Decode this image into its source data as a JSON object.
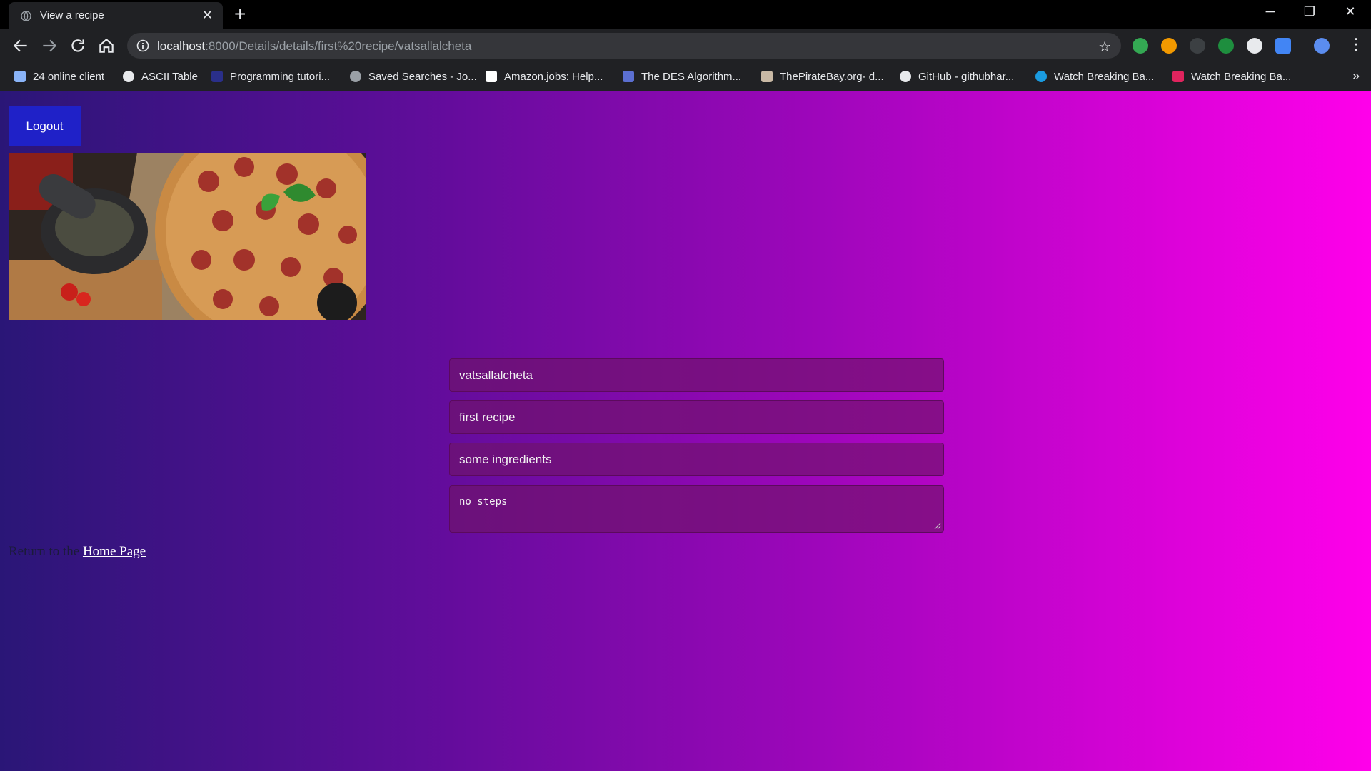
{
  "browser": {
    "tab_title": "View a recipe",
    "url_host": "localhost",
    "url_rest": ":8000/Details/details/first%20recipe/vatsallalcheta",
    "bookmarks": [
      {
        "label": "24 online client",
        "color": "#8ab4f8"
      },
      {
        "label": "ASCII Table",
        "color": "#e8eaed"
      },
      {
        "label": "Programming tutori...",
        "color": "#2a2f8a"
      },
      {
        "label": "Saved Searches - Jo...",
        "color": "#9aa0a6"
      },
      {
        "label": "Amazon.jobs: Help...",
        "color": "#ffffff"
      },
      {
        "label": "The DES Algorithm...",
        "color": "#5b6fd1"
      },
      {
        "label": "ThePirateBay.org- d...",
        "color": "#c9b9a5"
      },
      {
        "label": "GitHub - githubhar...",
        "color": "#e8eaed"
      },
      {
        "label": "Watch Breaking Ba...",
        "color": "#1a9be0"
      },
      {
        "label": "Watch Breaking Ba...",
        "color": "#e0245e"
      }
    ]
  },
  "page": {
    "logout_label": "Logout",
    "image_alt": "pizza photo",
    "fields": {
      "username": "vatsallalcheta",
      "recipe_name": "first recipe",
      "ingredients": "some ingredients",
      "steps": "no steps"
    },
    "return_prefix": "Return to the ",
    "return_link": "Home Page"
  },
  "colors": {
    "gradient_start": "#2a1677",
    "gradient_end": "#ff00ea",
    "logout_bg": "#1f21c8"
  }
}
